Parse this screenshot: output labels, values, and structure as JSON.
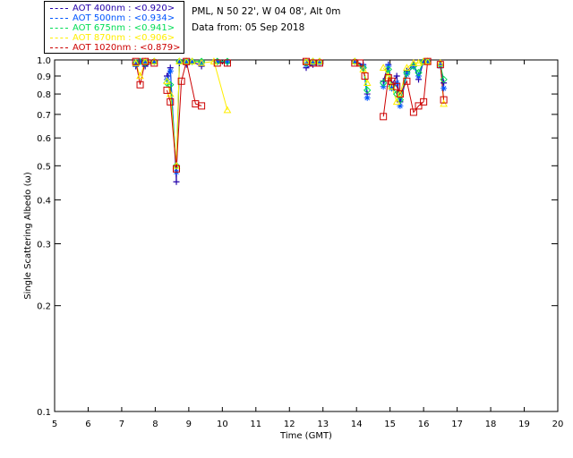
{
  "header": {
    "site_line": "PML, N 50 22', W 04 08', Alt 0m",
    "date_line": "Data from: 05 Sep 2018"
  },
  "legend": [
    {
      "label": "AOT  400nm : <0.920>",
      "color": "#2200aa"
    },
    {
      "label": "AOT  500nm : <0.934>",
      "color": "#0055ff"
    },
    {
      "label": "AOT  675nm : <0.941>",
      "color": "#00dd55"
    },
    {
      "label": "AOT  870nm : <0.906>",
      "color": "#ffee00"
    },
    {
      "label": "AOT 1020nm : <0.879>",
      "color": "#cc0000"
    }
  ],
  "chart_data": {
    "type": "line",
    "xlabel": "Time (GMT)",
    "ylabel": "Single Scattering Albedo (ω)",
    "xlim": [
      5,
      20
    ],
    "ylim": [
      0.1,
      1.0
    ],
    "yscale": "log",
    "xticks": [
      "5",
      "6",
      "7",
      "8",
      "9",
      "10",
      "11",
      "12",
      "13",
      "14",
      "15",
      "16",
      "17",
      "18",
      "19",
      "20"
    ],
    "yticks": [
      {
        "value": 1.0,
        "label": "1.0"
      },
      {
        "value": 0.9,
        "label": "0.9"
      },
      {
        "value": 0.8,
        "label": "0.8"
      },
      {
        "value": 0.7,
        "label": "0.7"
      },
      {
        "value": 0.6,
        "label": "0.6"
      },
      {
        "value": 0.5,
        "label": "0.5"
      },
      {
        "value": 0.4,
        "label": "0.4"
      },
      {
        "value": 0.3,
        "label": "0.3"
      },
      {
        "value": 0.2,
        "label": "0.2"
      },
      {
        "value": 0.1,
        "label": "0.1"
      }
    ],
    "series": [
      {
        "name": "AOT  400nm",
        "color": "#2200aa",
        "marker": "plus",
        "segments": [
          [
            [
              7.42,
              0.96
            ],
            [
              7.55,
              0.99
            ],
            [
              7.7,
              0.96
            ],
            [
              7.97,
              0.99
            ]
          ],
          [
            [
              8.35,
              0.9
            ],
            [
              8.45,
              0.95
            ],
            [
              8.63,
              0.45
            ],
            [
              8.72,
              0.98
            ],
            [
              8.93,
              0.97
            ],
            [
              9.1,
              0.99
            ],
            [
              9.38,
              0.96
            ]
          ],
          [
            [
              9.85,
              0.99
            ],
            [
              10.15,
              0.98
            ]
          ],
          [
            [
              12.5,
              0.95
            ],
            [
              12.7,
              0.97
            ],
            [
              12.9,
              0.98
            ]
          ],
          [
            [
              13.95,
              0.99
            ],
            [
              14.2,
              0.97
            ],
            [
              14.32,
              0.8
            ]
          ],
          [
            [
              14.8,
              0.87
            ],
            [
              14.95,
              0.97
            ],
            [
              15.05,
              0.85
            ],
            [
              15.2,
              0.9
            ],
            [
              15.3,
              0.76
            ],
            [
              15.5,
              0.93
            ],
            [
              15.7,
              0.97
            ],
            [
              15.85,
              0.88
            ],
            [
              16.0,
              0.99
            ],
            [
              16.12,
              0.99
            ]
          ],
          [
            [
              16.5,
              0.97
            ],
            [
              16.6,
              0.86
            ]
          ]
        ]
      },
      {
        "name": "AOT  500nm",
        "color": "#0055ff",
        "marker": "star",
        "segments": [
          [
            [
              7.42,
              0.97
            ],
            [
              7.55,
              0.99
            ],
            [
              7.7,
              0.98
            ],
            [
              7.97,
              0.99
            ]
          ],
          [
            [
              8.35,
              0.88
            ],
            [
              8.45,
              0.93
            ],
            [
              8.63,
              0.48
            ],
            [
              8.72,
              0.99
            ],
            [
              8.93,
              0.99
            ],
            [
              9.1,
              0.99
            ],
            [
              9.38,
              0.98
            ]
          ],
          [
            [
              9.85,
              0.99
            ],
            [
              10.15,
              0.99
            ]
          ],
          [
            [
              12.5,
              0.97
            ],
            [
              12.7,
              0.98
            ],
            [
              12.9,
              0.98
            ]
          ],
          [
            [
              13.95,
              0.99
            ],
            [
              14.2,
              0.96
            ],
            [
              14.32,
              0.78
            ]
          ],
          [
            [
              14.8,
              0.84
            ],
            [
              14.95,
              0.96
            ],
            [
              15.05,
              0.83
            ],
            [
              15.2,
              0.86
            ],
            [
              15.3,
              0.74
            ],
            [
              15.5,
              0.91
            ],
            [
              15.7,
              0.96
            ],
            [
              15.85,
              0.9
            ],
            [
              16.0,
              0.99
            ],
            [
              16.12,
              0.99
            ]
          ],
          [
            [
              16.5,
              0.96
            ],
            [
              16.6,
              0.83
            ]
          ]
        ]
      },
      {
        "name": "AOT  675nm",
        "color": "#00dd55",
        "marker": "diamond",
        "segments": [
          [
            [
              7.42,
              0.98
            ],
            [
              7.55,
              0.99
            ],
            [
              7.7,
              0.98
            ],
            [
              7.97,
              0.99
            ]
          ],
          [
            [
              8.35,
              0.86
            ],
            [
              8.45,
              0.85
            ],
            [
              8.63,
              0.5
            ],
            [
              8.72,
              0.99
            ],
            [
              8.93,
              0.99
            ],
            [
              9.1,
              0.99
            ],
            [
              9.38,
              0.99
            ]
          ],
          [
            [
              9.85,
              0.99
            ],
            [
              10.15,
              0.99
            ]
          ],
          [
            [
              12.5,
              0.98
            ],
            [
              12.7,
              0.99
            ],
            [
              12.9,
              0.99
            ]
          ],
          [
            [
              13.95,
              0.99
            ],
            [
              14.2,
              0.95
            ],
            [
              14.32,
              0.82
            ]
          ],
          [
            [
              14.8,
              0.86
            ],
            [
              14.95,
              0.94
            ],
            [
              15.05,
              0.84
            ],
            [
              15.2,
              0.8
            ],
            [
              15.3,
              0.77
            ],
            [
              15.5,
              0.92
            ],
            [
              15.7,
              0.96
            ],
            [
              15.85,
              0.92
            ],
            [
              16.0,
              0.99
            ],
            [
              16.12,
              0.99
            ]
          ],
          [
            [
              16.5,
              0.97
            ],
            [
              16.6,
              0.88
            ]
          ]
        ]
      },
      {
        "name": "AOT  870nm",
        "color": "#ffee00",
        "marker": "triangle",
        "segments": [
          [
            [
              7.42,
              0.98
            ],
            [
              7.55,
              0.9
            ],
            [
              7.7,
              0.99
            ],
            [
              7.97,
              0.99
            ]
          ],
          [
            [
              8.35,
              0.87
            ],
            [
              8.45,
              0.8
            ],
            [
              8.63,
              0.5
            ],
            [
              8.72,
              0.99
            ],
            [
              8.93,
              0.99
            ],
            [
              9.1,
              0.99
            ],
            [
              9.38,
              0.98
            ],
            [
              9.75,
              0.99
            ],
            [
              10.15,
              0.72
            ]
          ],
          [
            [
              12.5,
              0.99
            ],
            [
              12.7,
              0.99
            ],
            [
              12.9,
              0.99
            ]
          ],
          [
            [
              13.95,
              0.99
            ],
            [
              14.2,
              0.94
            ],
            [
              14.32,
              0.86
            ]
          ],
          [
            [
              14.8,
              0.95
            ],
            [
              14.95,
              0.9
            ],
            [
              15.05,
              0.84
            ],
            [
              15.2,
              0.76
            ],
            [
              15.3,
              0.8
            ],
            [
              15.5,
              0.95
            ],
            [
              15.7,
              0.98
            ],
            [
              15.85,
              0.98
            ],
            [
              16.0,
              0.99
            ],
            [
              16.12,
              0.99
            ]
          ],
          [
            [
              16.5,
              0.98
            ],
            [
              16.6,
              0.75
            ]
          ]
        ]
      },
      {
        "name": "AOT 1020nm",
        "color": "#cc0000",
        "marker": "square",
        "segments": [
          [
            [
              7.42,
              0.99
            ],
            [
              7.55,
              0.85
            ],
            [
              7.7,
              0.99
            ],
            [
              7.97,
              0.98
            ]
          ],
          [
            [
              8.35,
              0.82
            ],
            [
              8.45,
              0.76
            ],
            [
              8.63,
              0.49
            ],
            [
              8.78,
              0.87
            ],
            [
              8.93,
              0.99
            ],
            [
              9.2,
              0.75
            ],
            [
              9.38,
              0.74
            ]
          ],
          [
            [
              9.85,
              0.98
            ],
            [
              10.15,
              0.98
            ]
          ],
          [
            [
              12.5,
              0.99
            ],
            [
              12.7,
              0.98
            ],
            [
              12.9,
              0.98
            ]
          ],
          [
            [
              13.95,
              0.98
            ],
            [
              14.1,
              0.98
            ],
            [
              14.25,
              0.9
            ]
          ],
          [
            [
              14.8,
              0.69
            ],
            [
              14.95,
              0.89
            ],
            [
              15.05,
              0.87
            ],
            [
              15.2,
              0.84
            ],
            [
              15.3,
              0.8
            ],
            [
              15.5,
              0.87
            ],
            [
              15.7,
              0.71
            ],
            [
              15.85,
              0.74
            ],
            [
              16.0,
              0.76
            ],
            [
              16.12,
              0.99
            ]
          ],
          [
            [
              16.5,
              0.97
            ],
            [
              16.6,
              0.77
            ]
          ]
        ]
      }
    ]
  }
}
